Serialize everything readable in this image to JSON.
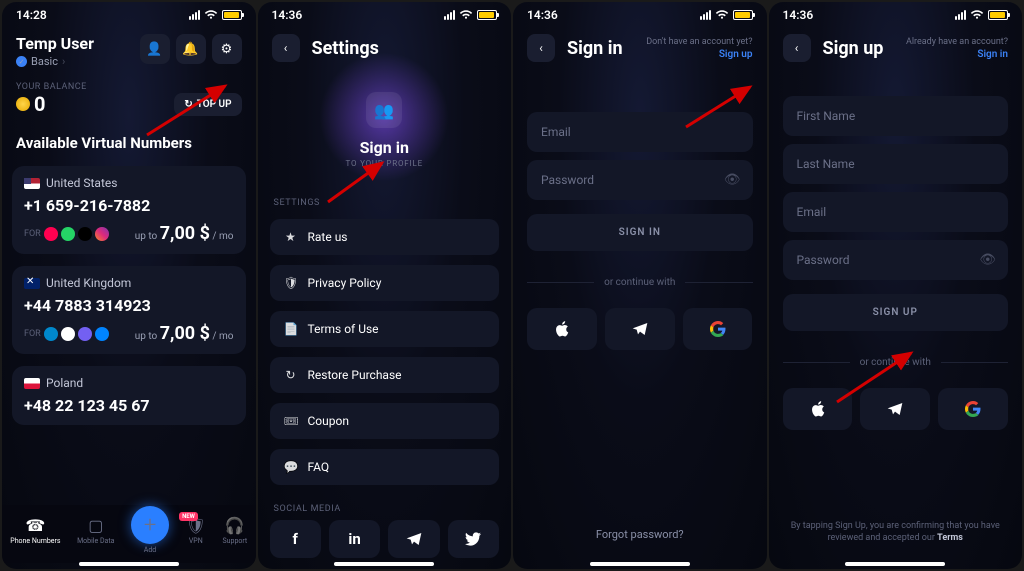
{
  "screen1": {
    "time": "14:28",
    "user": "Temp User",
    "plan": "Basic",
    "balance_label": "YOUR BALANCE",
    "balance": "0",
    "topup": "TOP UP",
    "avail_title": "Available Virtual Numbers",
    "numbers": [
      {
        "country": "United States",
        "phone": "+1 659-216-7882",
        "price_prefix": "up to",
        "price": "7,00 $",
        "suffix": "/ mo"
      },
      {
        "country": "United Kingdom",
        "phone": "+44 7883 314923",
        "price_prefix": "up to",
        "price": "7,00 $",
        "suffix": "/ mo"
      },
      {
        "country": "Poland",
        "phone": "+48 22 123 45 67",
        "price_prefix": "",
        "price": "",
        "suffix": ""
      }
    ],
    "for_label": "FOR",
    "tabs": [
      "Phone Numbers",
      "Mobile Data",
      "Add",
      "VPN",
      "Support"
    ],
    "new_badge": "NEW"
  },
  "screen2": {
    "time": "14:36",
    "title": "Settings",
    "signin_title": "Sign in",
    "signin_sub": "TO YOUR PROFILE",
    "section_settings": "SETTINGS",
    "items": [
      "Rate us",
      "Privacy Policy",
      "Terms of Use",
      "Restore Purchase",
      "Coupon",
      "FAQ"
    ],
    "section_social": "SOCIAL MEDIA"
  },
  "screen3": {
    "time": "14:36",
    "title": "Sign in",
    "hint": "Don't have an account yet?",
    "link": "Sign up",
    "fields": {
      "email": "Email",
      "password": "Password"
    },
    "button": "SIGN IN",
    "divider": "or continue with",
    "forgot": "Forgot password?"
  },
  "screen4": {
    "time": "14:36",
    "title": "Sign up",
    "hint": "Already have an account?",
    "link": "Sign in",
    "fields": {
      "fname": "First Name",
      "lname": "Last Name",
      "email": "Email",
      "password": "Password"
    },
    "button": "SIGN UP",
    "divider": "or continue with",
    "terms_pre": "By tapping Sign Up, you are confirming that you have reviewed and accepted our ",
    "terms_link": "Terms"
  }
}
